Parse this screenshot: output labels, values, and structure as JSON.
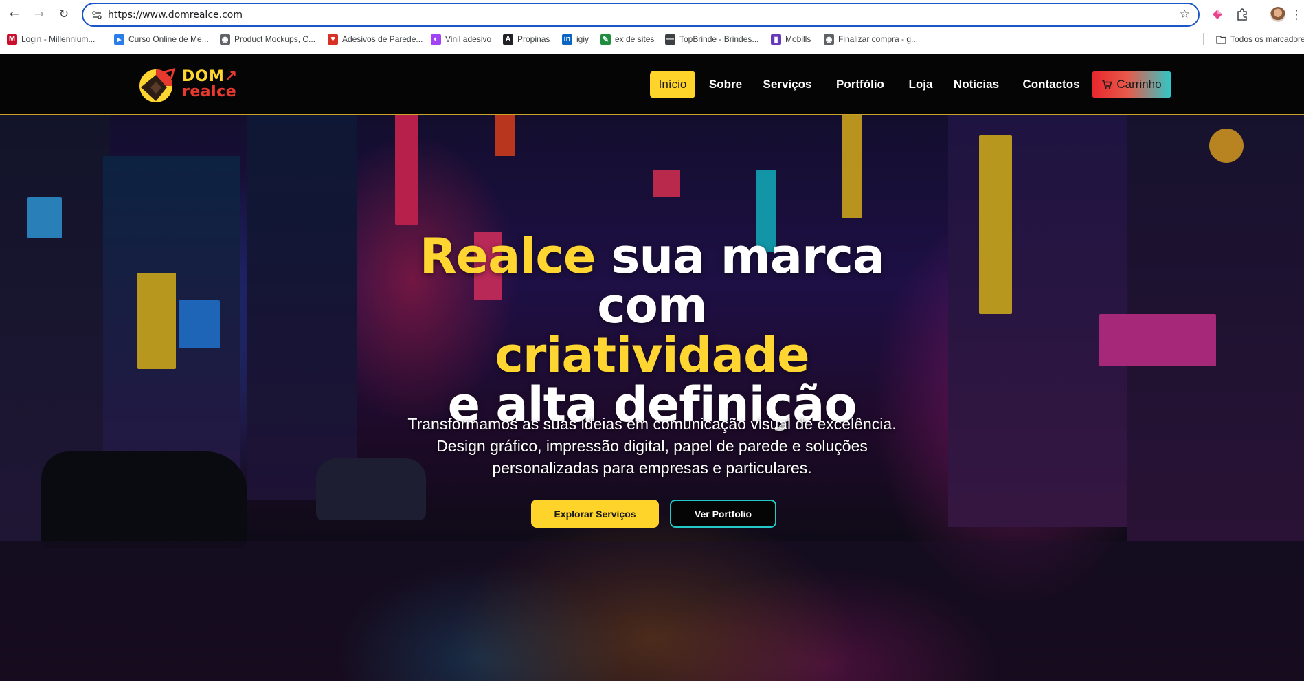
{
  "browser": {
    "url": "https://www.domrealce.com",
    "bookmarks": [
      {
        "label": "Login - Millennium...",
        "icon": "millennium-icon",
        "color": "#c8102e",
        "glyph": "M"
      },
      {
        "label": "Curso Online de Me...",
        "icon": "course-icon",
        "color": "#2b7de9",
        "glyph": "▸"
      },
      {
        "label": "Product Mockups, C...",
        "icon": "globe-icon",
        "color": "#5f6368",
        "glyph": "◉"
      },
      {
        "label": "Adesivos de Parede...",
        "icon": "heart-icon",
        "color": "#d93025",
        "glyph": "♥"
      },
      {
        "label": "Vinil adesivo",
        "icon": "vinil-icon",
        "color": "#a142f4",
        "glyph": "◐"
      },
      {
        "label": "Propinas",
        "icon": "propinas-icon",
        "color": "#202124",
        "glyph": "A"
      },
      {
        "label": "igiy",
        "icon": "linkedin-icon",
        "color": "#0a66c2",
        "glyph": "in"
      },
      {
        "label": "ex de sites",
        "icon": "pen-icon",
        "color": "#1e8e3e",
        "glyph": "✎"
      },
      {
        "label": "TopBrinde - Brindes...",
        "icon": "topbrinde-icon",
        "color": "#3c4043",
        "glyph": "—"
      },
      {
        "label": "Mobills",
        "icon": "mobills-icon",
        "color": "#673ab7",
        "glyph": "▮"
      },
      {
        "label": "Finalizar compra - g...",
        "icon": "globe-icon",
        "color": "#5f6368",
        "glyph": "◉"
      }
    ],
    "all_bookmarks": "Todos os marcadores"
  },
  "site": {
    "logo": {
      "line1": "DOM",
      "line2": "realce",
      "arrow": "↗"
    },
    "nav": [
      "Início",
      "Sobre",
      "Serviços",
      "Portfólio",
      "Loja",
      "Notícias",
      "Contactos"
    ],
    "cart": "Carrinho"
  },
  "hero": {
    "title_part1": "Realce",
    "title_part2": " sua marca",
    "title_part3": "com",
    "title_part4": "criatividade",
    "title_part5": "e alta definição",
    "subtitle": "Transformamos as suas ideias em comunicação visual de excelência. Design gráfico, impressão digital, papel de parede e soluções personalizadas para empresas e particulares.",
    "cta_primary": "Explorar Serviços",
    "cta_secondary": "Ver Portfolio"
  },
  "colors": {
    "accent_yellow": "#ffd42a",
    "accent_teal": "#23c9c9",
    "cart_red": "#e8262c",
    "omnibox_focus": "#1a56c5"
  }
}
